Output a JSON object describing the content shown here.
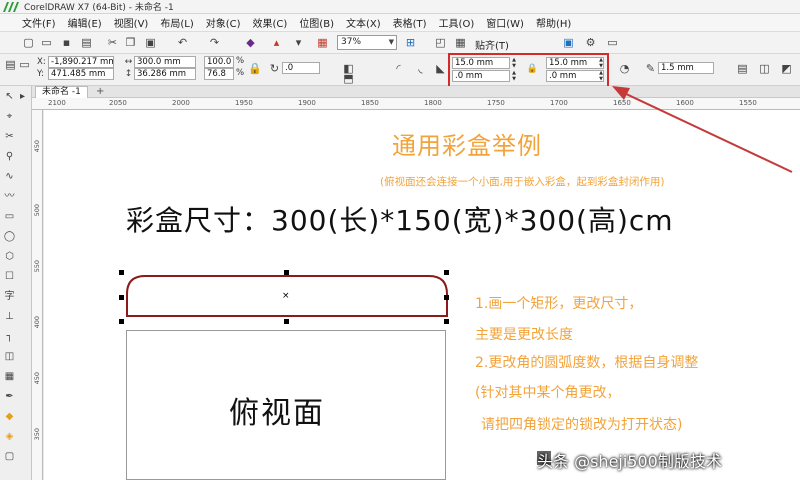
{
  "window": {
    "title": "CorelDRAW X7 (64-Bit) - 未命名 -1"
  },
  "menu": [
    "文件(F)",
    "编辑(E)",
    "视图(V)",
    "布局(L)",
    "对象(C)",
    "效果(C)",
    "位图(B)",
    "文本(X)",
    "表格(T)",
    "工具(O)",
    "窗口(W)",
    "帮助(H)"
  ],
  "toolbar": {
    "zoom": "37%",
    "snap_label": "贴齐(T)"
  },
  "properties": {
    "x_label": "X:",
    "x_value": "-1,890.217 mm",
    "y_label": "Y:",
    "y_value": "471.485 mm",
    "w_value": "300.0 mm",
    "h_value": "36.286 mm",
    "scale_w": "100.0",
    "scale_h": "76.8",
    "pct": "%",
    "angle": ".0",
    "corner_tl": "15.0 mm",
    "corner_bl": ".0 mm",
    "corner_tr": "15.0 mm",
    "corner_br": ".0 mm",
    "outline": "1.5 mm"
  },
  "tabs": {
    "document": "未命名 -1",
    "add": "+"
  },
  "ruler_h": [
    "2100",
    "2050",
    "2000",
    "1950",
    "1900",
    "1850",
    "1800",
    "1750",
    "1700",
    "1650",
    "1600",
    "1550"
  ],
  "ruler_v": [
    "450",
    "500",
    "550",
    "400",
    "450",
    "350"
  ],
  "canvas": {
    "heading": "通用彩盒举例",
    "subheading": "(俯视面还会连接一个小面,用于嵌入彩盒，起到彩盒封闭作用)",
    "size_text": "彩盒尺寸：300(长)*150(宽)*300(高)cm",
    "steps": [
      "1.画一个矩形，更改尺寸，",
      "主要是更改长度",
      "2.更改角的圆弧度数，根据自身调整",
      "(针对其中某个角更改，",
      "请把四角锁定的锁改为打开状态)"
    ],
    "face_label": "俯视面"
  },
  "watermark": "头条 @sheji500制版技术",
  "colors": {
    "accent": "#f2a33a",
    "highlight": "#d42a2a",
    "shape_outline": "#8b1a1a"
  }
}
